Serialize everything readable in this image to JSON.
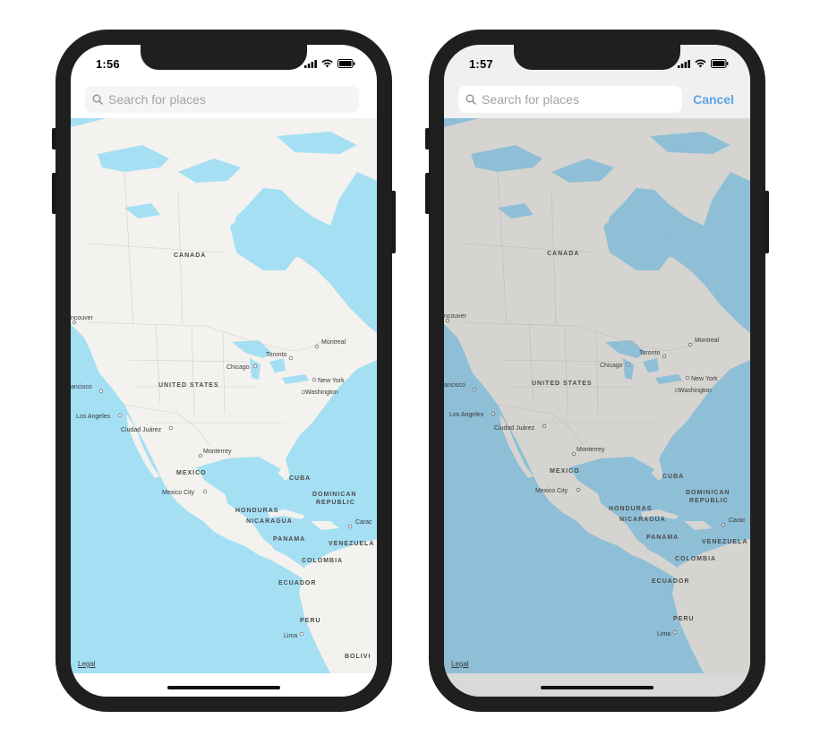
{
  "phones": [
    {
      "time": "1:56",
      "search_placeholder": "Search for places",
      "cancel_label": "",
      "legal_label": "Legal",
      "dimmed": false
    },
    {
      "time": "1:57",
      "search_placeholder": "Search for places",
      "cancel_label": "Cancel",
      "legal_label": "Legal",
      "dimmed": true
    }
  ],
  "map_labels": {
    "countries": [
      "CANADA",
      "UNITED STATES",
      "MEXICO",
      "CUBA",
      "DOMINICAN",
      "REPUBLIC",
      "HONDURAS",
      "NICARAGUA",
      "PANAMA",
      "VENEZUELA",
      "COLOMBIA",
      "ECUADOR",
      "PERU",
      "BOLIVI"
    ],
    "cities": [
      "Vancouver",
      "San Francisco",
      "Los Angeles",
      "Ciudad Juárez",
      "Monterrey",
      "Mexico City",
      "Chicago",
      "Toronto",
      "Montreal",
      "New York",
      "Washington",
      "Lima",
      "Caracas"
    ]
  },
  "colors": {
    "water": "#a4dff4",
    "land": "#f3f2ee",
    "water_dimmed": "#8ebfd6",
    "land_dimmed": "#d6d4d0",
    "accent": "#5aa6e6"
  }
}
